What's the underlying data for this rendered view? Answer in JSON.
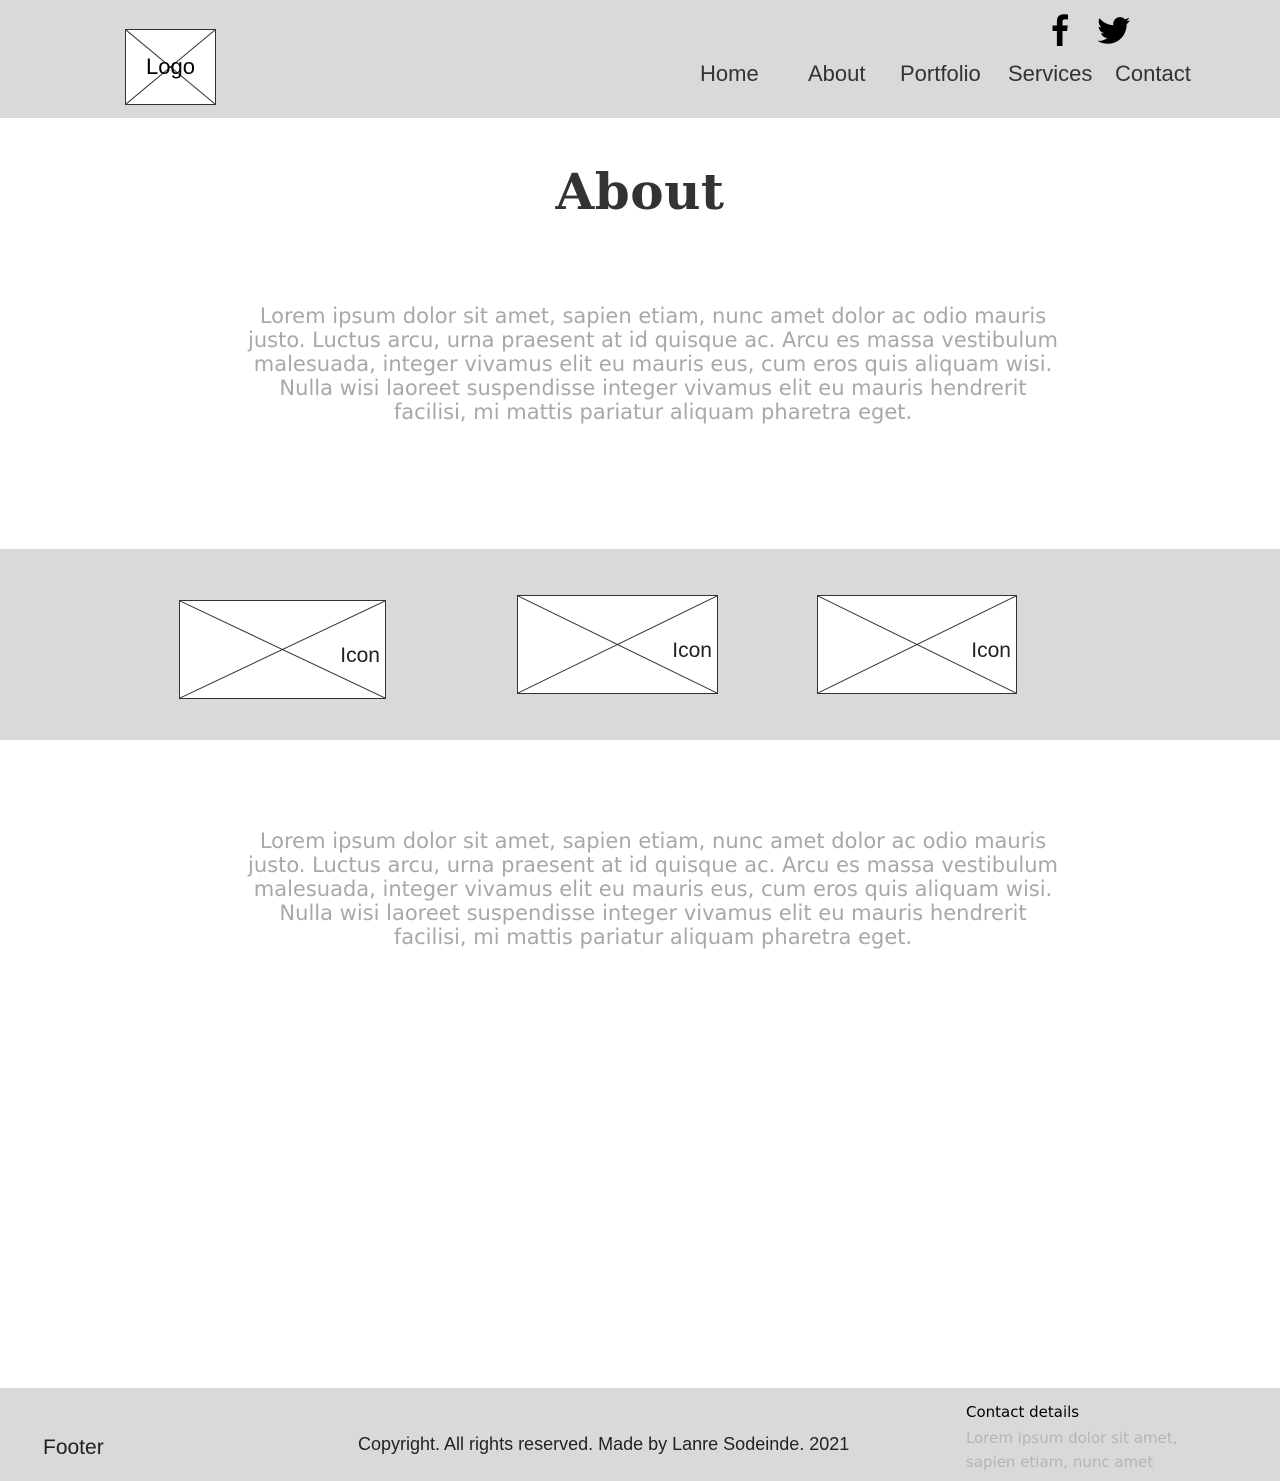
{
  "header": {
    "logo_label": "Logo",
    "social": [
      "facebook-icon",
      "twitter-icon"
    ],
    "nav": {
      "home": "Home",
      "about": "About",
      "portfolio": "Portfolio",
      "services": "Services",
      "contact": "Contact"
    }
  },
  "main": {
    "title": "About",
    "paragraph_1": "Lorem ipsum dolor sit amet, sapien etiam, nunc amet dolor ac odio mauris justo. Luctus arcu, urna praesent at id quisque ac. Arcu es massa vestibulum malesuada, integer vivamus elit eu mauris eus, cum eros quis aliquam wisi. Nulla wisi laoreet suspendisse integer vivamus elit eu mauris hendrerit facilisi, mi mattis pariatur aliquam pharetra eget.",
    "icons": [
      {
        "label": "Icon"
      },
      {
        "label": "Icon"
      },
      {
        "label": "Icon"
      }
    ],
    "paragraph_2": "Lorem ipsum dolor sit amet, sapien etiam, nunc amet dolor ac odio mauris justo. Luctus arcu, urna praesent at id quisque ac. Arcu es massa vestibulum malesuada, integer vivamus elit eu mauris eus, cum eros quis aliquam wisi. Nulla wisi laoreet suspendisse integer vivamus elit eu mauris hendrerit facilisi, mi mattis pariatur aliquam pharetra eget."
  },
  "footer": {
    "label": "Footer",
    "copyright": "Copyright. All rights reserved. Made by Lanre Sodeinde. 2021",
    "contact_title": "Contact details",
    "contact_text": "Lorem ipsum dolor sit amet, sapien etiam, nunc amet"
  },
  "colors": {
    "band": "#d9d9d9",
    "text_muted": "#a8a8a8",
    "text_dark": "#333333"
  }
}
